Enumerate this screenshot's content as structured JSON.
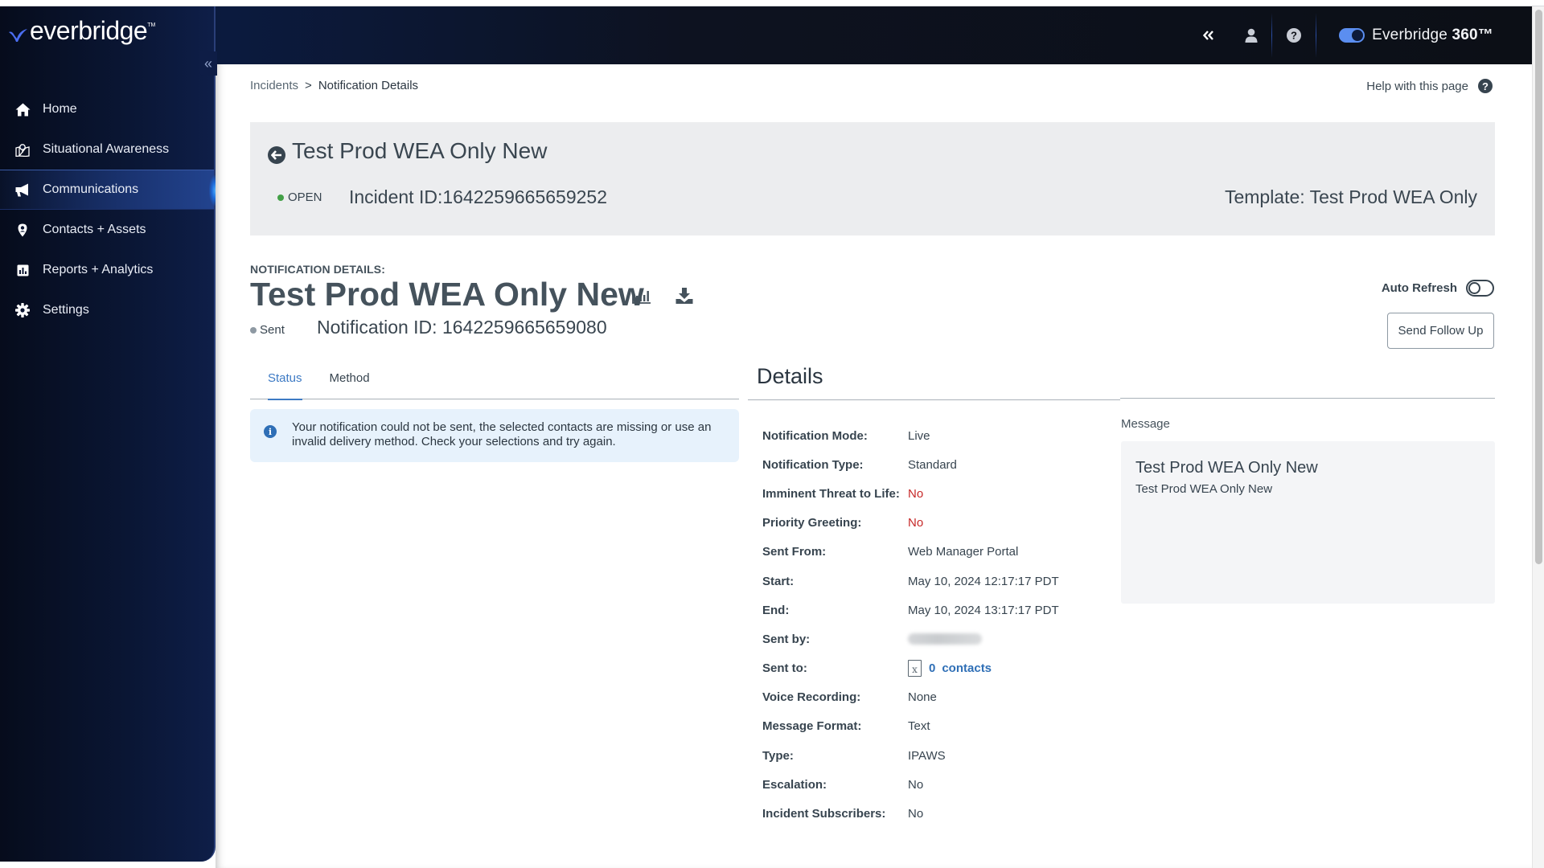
{
  "app": {
    "brand": "everbridge",
    "brand_360_prefix": "Everbridge ",
    "brand_360_suffix": "360™",
    "accent_color": "#3d7ac4"
  },
  "topbar": {
    "icons": [
      "double-chevron-left-icon",
      "user-icon",
      "help-icon"
    ],
    "toggle_360_on": true
  },
  "sidebar": {
    "collapse_icon": "«",
    "items": [
      {
        "label": "Home",
        "icon": "home-icon",
        "active": false
      },
      {
        "label": "Situational Awareness",
        "icon": "map-pin-icon",
        "active": false
      },
      {
        "label": "Communications",
        "icon": "megaphone-icon",
        "active": true
      },
      {
        "label": "Contacts + Assets",
        "icon": "location-pin-icon",
        "active": false
      },
      {
        "label": "Reports + Analytics",
        "icon": "bar-chart-icon",
        "active": false
      },
      {
        "label": "Settings",
        "icon": "gear-icon",
        "active": false
      }
    ]
  },
  "breadcrumb": {
    "parent": "Incidents",
    "separator": ">",
    "current": "Notification Details"
  },
  "help": {
    "label": "Help with this page"
  },
  "incident": {
    "title": "Test Prod WEA Only New",
    "status": "OPEN",
    "status_color": "#43a047",
    "incident_id": "Incident ID:1642259665659252",
    "template": "Template: Test Prod WEA Only"
  },
  "notification": {
    "section_label": "NOTIFICATION DETAILS:",
    "title": "Test Prod WEA Only New",
    "status": "Sent",
    "notification_id": "Notification ID: 1642259665659080",
    "auto_refresh_label": "Auto Refresh",
    "auto_refresh_on": false,
    "send_follow_up_label": "Send Follow Up"
  },
  "tabs": [
    {
      "label": "Status",
      "active": true
    },
    {
      "label": "Method",
      "active": false
    }
  ],
  "alert": {
    "text": "Your notification could not be sent, the selected contacts are missing or use an invalid delivery method. Check your selections and try again."
  },
  "details": {
    "heading": "Details",
    "rows": [
      {
        "label": "Notification Mode:",
        "value": "Live"
      },
      {
        "label": "Notification Type:",
        "value": "Standard"
      },
      {
        "label": "Imminent Threat to Life:",
        "value": "No"
      },
      {
        "label": "Priority Greeting:",
        "value": "No"
      },
      {
        "label": "Sent From:",
        "value": "Web Manager Portal"
      },
      {
        "label": "Start:",
        "value": "May 10, 2024 12:17:17 PDT"
      },
      {
        "label": "End:",
        "value": "May 10, 2024 13:17:17 PDT"
      },
      {
        "label": "Sent by:",
        "value": ""
      },
      {
        "label": "Sent to:",
        "count": "0",
        "link_label": "contacts"
      },
      {
        "label": "Voice Recording:",
        "value": "None"
      },
      {
        "label": "Message Format:",
        "value": "Text"
      },
      {
        "label": "Type:",
        "value": "IPAWS"
      },
      {
        "label": "Escalation:",
        "value": "No"
      },
      {
        "label": "Incident Subscribers:",
        "value": "No"
      }
    ]
  },
  "message": {
    "label": "Message",
    "title": "Test Prod WEA Only New",
    "body": "Test Prod WEA Only New"
  }
}
